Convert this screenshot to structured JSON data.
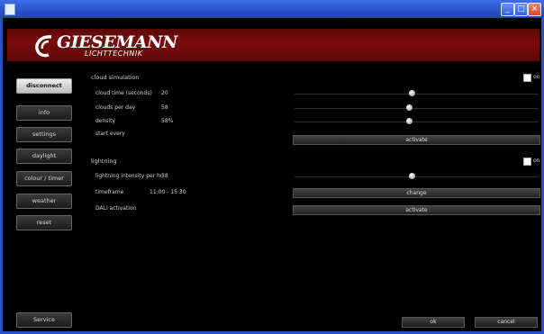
{
  "window": {
    "minimize_glyph": "_",
    "maximize_glyph": "□",
    "close_glyph": "×"
  },
  "brand": {
    "name": "GIESEMANN",
    "subtitle": "LICHTTECHNIK"
  },
  "nav": {
    "disconnect": "disconnect",
    "items": [
      "info",
      "settings",
      "daylight",
      "colour / timer",
      "weather",
      "reset"
    ],
    "bottom": "Service"
  },
  "cloud": {
    "title": "cloud simulation",
    "on_label": "on",
    "rows": [
      {
        "label": "cloud time (seconds)",
        "value": "20"
      },
      {
        "label": "clouds per day",
        "value": "58"
      },
      {
        "label": "density",
        "value": "58%"
      },
      {
        "label": "start every",
        "value": ""
      }
    ],
    "slider_levels": [
      0.48,
      0.47,
      0.47
    ],
    "button": "activate"
  },
  "storm": {
    "title": "lightning",
    "on_label": "on",
    "rows": [
      {
        "label": "lightning intensity per hr",
        "value": "38"
      },
      {
        "label": "timeframe",
        "value": "11:00 - 15:30"
      },
      {
        "label": "DALI activation",
        "value": ""
      }
    ],
    "slider_levels": [
      0.48
    ],
    "buttons": [
      "change",
      "activate"
    ]
  },
  "footer": {
    "ok": "ok",
    "cancel": "cancel"
  }
}
